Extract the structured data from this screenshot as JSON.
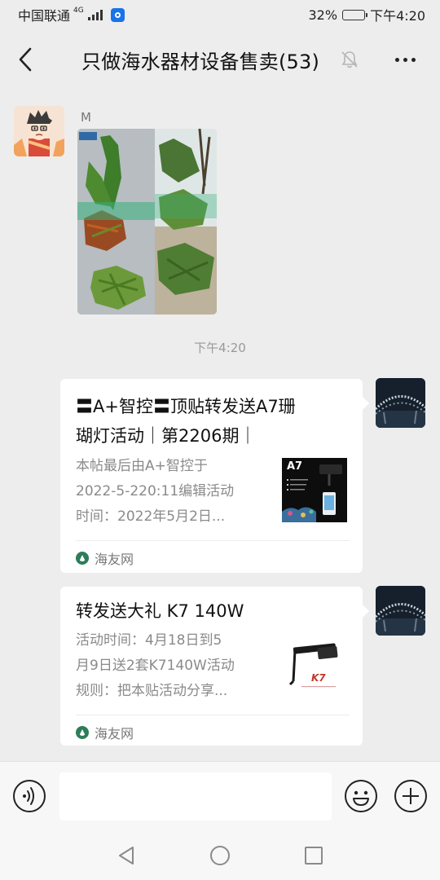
{
  "status_bar": {
    "carrier": "中国联通",
    "network": "4G",
    "battery": "32%",
    "battery_level": 0.32,
    "time": "下午4:20"
  },
  "header": {
    "title": "只做海水器材设备售卖(53)",
    "back_icon": "chevron-left-icon",
    "mute_icon": "bell-off-icon",
    "more_icon": "more-dots-icon"
  },
  "messages": {
    "photo_message": {
      "sender": "M"
    },
    "time_separator": "下午4:20",
    "link_cards": [
      {
        "title_line1": "〓A+智控〓顶贴转发送A7珊",
        "title_line2": "瑚灯活动｜第2206期｜",
        "desc_line1": "本帖最后由A+智控于",
        "desc_line2": "2022-5-220:11编辑活动",
        "desc_line3": "时间：2022年5月2日...",
        "thumb_label": "A7",
        "source": "海友网"
      },
      {
        "title_line1": "转发送大礼 K7 140W",
        "desc_line1": "活动时间：4月18日到5",
        "desc_line2": "月9日送2套K7140W活动",
        "desc_line3": "规则：把本贴活动分享...",
        "source": "海友网"
      }
    ]
  },
  "input_bar": {
    "value": "",
    "voice_icon": "voice-icon",
    "emoji_icon": "emoji-icon",
    "plus_icon": "plus-icon"
  },
  "nav_bar": {
    "back_icon": "nav-back-icon",
    "home_icon": "nav-home-icon",
    "recent_icon": "nav-recents-icon"
  }
}
